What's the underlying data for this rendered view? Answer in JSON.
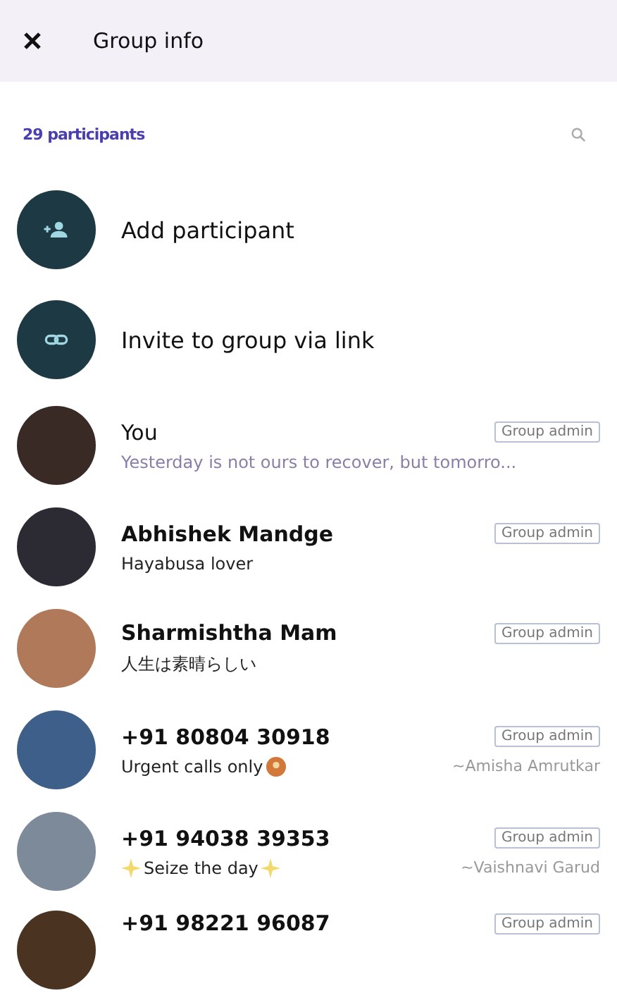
{
  "header": {
    "title": "Group info"
  },
  "participants": {
    "count_label": "29 participants"
  },
  "actions": [
    {
      "kind": "add",
      "label": "Add participant"
    },
    {
      "kind": "link",
      "label": "Invite to group via link"
    }
  ],
  "members": [
    {
      "kind": "self",
      "name": "You",
      "about": "Yesterday is not ours to recover, but tomorro...",
      "badge": "Group admin"
    },
    {
      "kind": "contact",
      "name": "Abhishek Mandge",
      "about": "Hayabusa lover",
      "badge": "Group admin"
    },
    {
      "kind": "contact",
      "name": "Sharmishtha Mam",
      "about": "人生は素晴らしい",
      "badge": "Group admin"
    },
    {
      "kind": "number",
      "name": "+91 80804 30918",
      "about_parts": [
        {
          "kind": "text",
          "text": "Urgent calls only"
        },
        {
          "kind": "emoji"
        }
      ],
      "pushname": "~Amisha Amrutkar",
      "badge": "Group admin"
    },
    {
      "kind": "number",
      "name": "+91 94038 39353",
      "about_parts": [
        {
          "kind": "sparkle"
        },
        {
          "kind": "text",
          "text": "Seize the day"
        },
        {
          "kind": "sparkle"
        }
      ],
      "pushname": "~Vaishnavi Garud",
      "badge": "Group admin"
    },
    {
      "kind": "number",
      "name": "+91 98221 96087",
      "badge": "Group admin"
    }
  ]
}
